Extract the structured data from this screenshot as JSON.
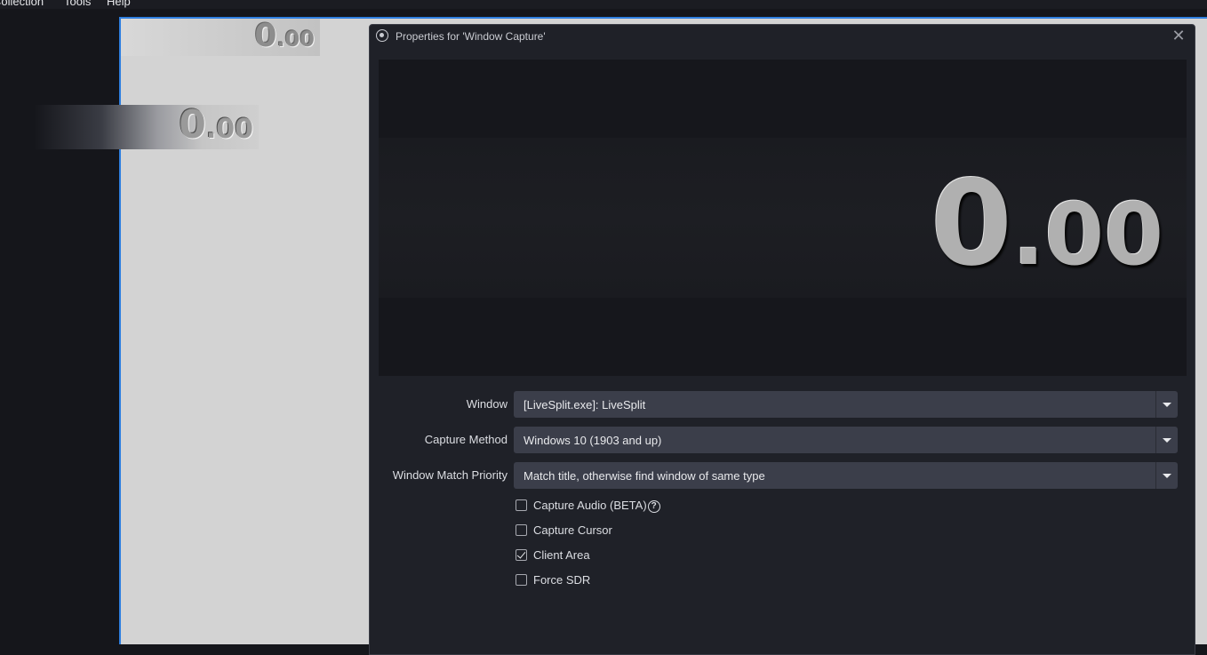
{
  "menubar": {
    "items": [
      "Collection",
      "Tools",
      "Help"
    ]
  },
  "canvas": {
    "timer_small": {
      "whole": "0",
      "fraction": ".00"
    },
    "timer_large": {
      "whole": "0",
      "fraction": ".00"
    }
  },
  "dialog": {
    "title": "Properties for 'Window Capture'",
    "close_glyph": "✕",
    "preview_timer": {
      "whole": "0",
      "fraction": ".00"
    },
    "fields": [
      {
        "label": "Window",
        "value": "[LiveSplit.exe]: LiveSplit"
      },
      {
        "label": "Capture Method",
        "value": "Windows 10 (1903 and up)"
      },
      {
        "label": "Window Match Priority",
        "value": "Match title, otherwise find window of same type"
      }
    ],
    "checkboxes": [
      {
        "label": "Capture Audio (BETA)",
        "checked": false,
        "help": "?"
      },
      {
        "label": "Capture Cursor",
        "checked": false
      },
      {
        "label": "Client Area",
        "checked": true
      },
      {
        "label": "Force SDR",
        "checked": false
      }
    ]
  },
  "colors": {
    "accent_border": "#2f7fe0",
    "dialog_bg": "#1f2128",
    "select_bg": "#3b3e4a"
  }
}
